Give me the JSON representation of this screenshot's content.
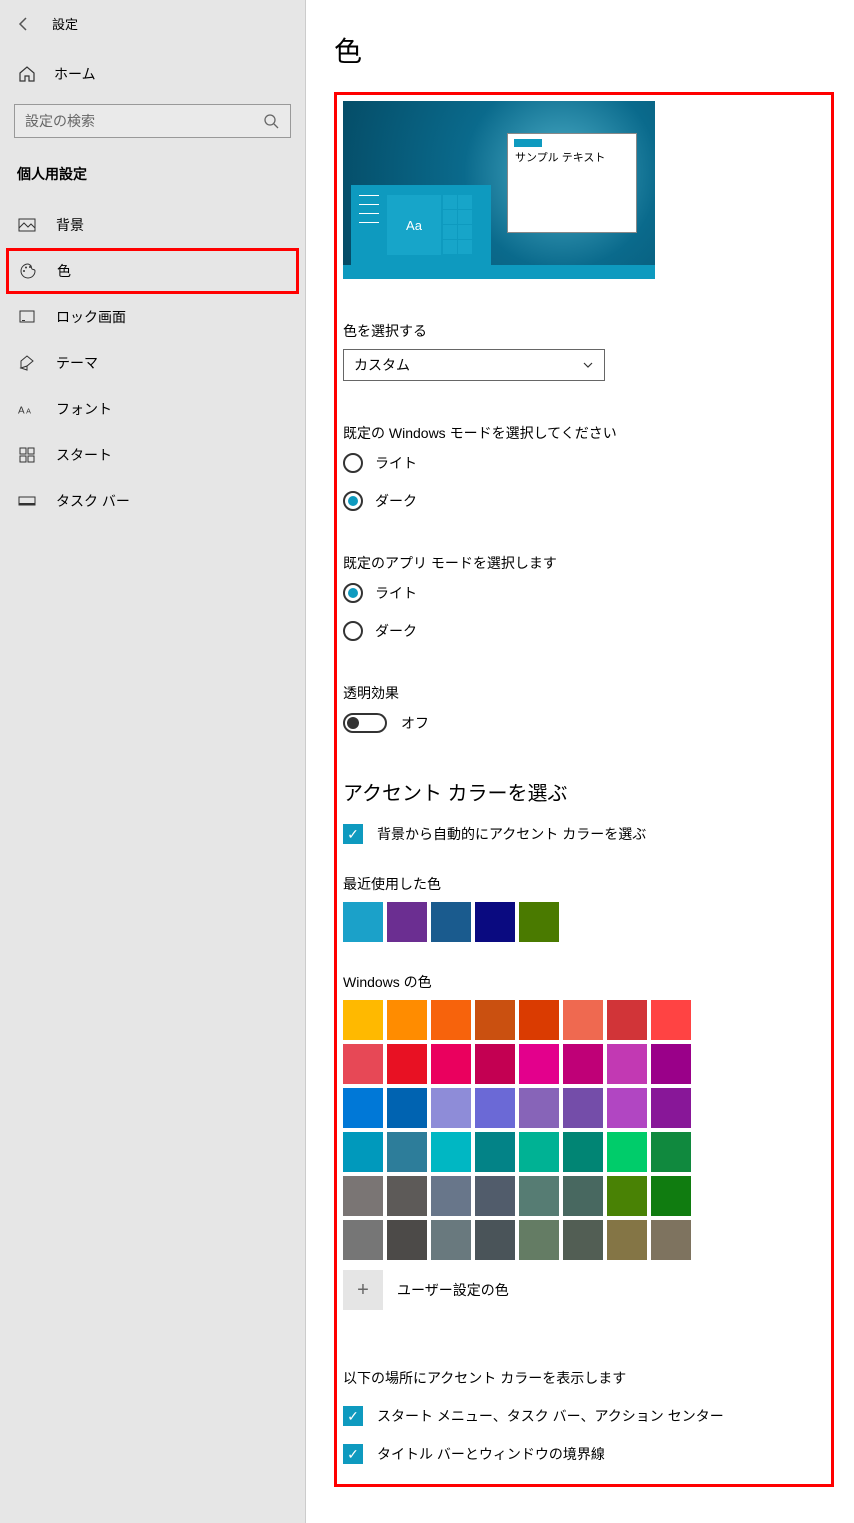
{
  "window": {
    "title": "設定"
  },
  "sidebar": {
    "home": "ホーム",
    "search_placeholder": "設定の検索",
    "section": "個人用設定",
    "items": [
      {
        "label": "背景"
      },
      {
        "label": "色"
      },
      {
        "label": "ロック画面"
      },
      {
        "label": "テーマ"
      },
      {
        "label": "フォント"
      },
      {
        "label": "スタート"
      },
      {
        "label": "タスク バー"
      }
    ]
  },
  "page": {
    "title": "色",
    "preview_sample": "サンプル テキスト",
    "preview_tile_text": "Aa",
    "choose_color_label": "色を選択する",
    "choose_color_value": "カスタム",
    "windows_mode_label": "既定の Windows モードを選択してください",
    "mode_light": "ライト",
    "mode_dark": "ダーク",
    "app_mode_label": "既定のアプリ モードを選択します",
    "transparency_label": "透明効果",
    "transparency_state": "オフ",
    "accent_title": "アクセント カラーを選ぶ",
    "auto_accent": "背景から自動的にアクセント カラーを選ぶ",
    "recent_label": "最近使用した色",
    "recent_colors": [
      "#1ba1c9",
      "#6b2e91",
      "#1a5b8e",
      "#0a0a80",
      "#4a7a00"
    ],
    "windows_colors_label": "Windows の色",
    "windows_colors": [
      "#ffb900",
      "#ff8c00",
      "#f7630c",
      "#ca5010",
      "#da3b01",
      "#ef6950",
      "#d13438",
      "#ff4343",
      "#e74856",
      "#e81123",
      "#ea005e",
      "#c30052",
      "#e3008c",
      "#bf0077",
      "#c239b3",
      "#9a0089",
      "#0078d7",
      "#0063b1",
      "#8e8cd8",
      "#6b69d6",
      "#8764b8",
      "#744da9",
      "#b146c2",
      "#881798",
      "#0099bc",
      "#2d7d9a",
      "#00b7c3",
      "#038387",
      "#00b294",
      "#018574",
      "#00cc6a",
      "#10893e",
      "#7a7574",
      "#5d5a58",
      "#68768a",
      "#515c6b",
      "#567c73",
      "#486860",
      "#498205",
      "#107c10",
      "#767676",
      "#4c4a48",
      "#69797e",
      "#4a5459",
      "#647c64",
      "#525e54",
      "#847545",
      "#7e735f"
    ],
    "custom_color": "ユーザー設定の色",
    "show_accent_label": "以下の場所にアクセント カラーを表示します",
    "surf_start": "スタート メニュー、タスク バー、アクション センター",
    "surf_title": "タイトル バーとウィンドウの境界線"
  }
}
